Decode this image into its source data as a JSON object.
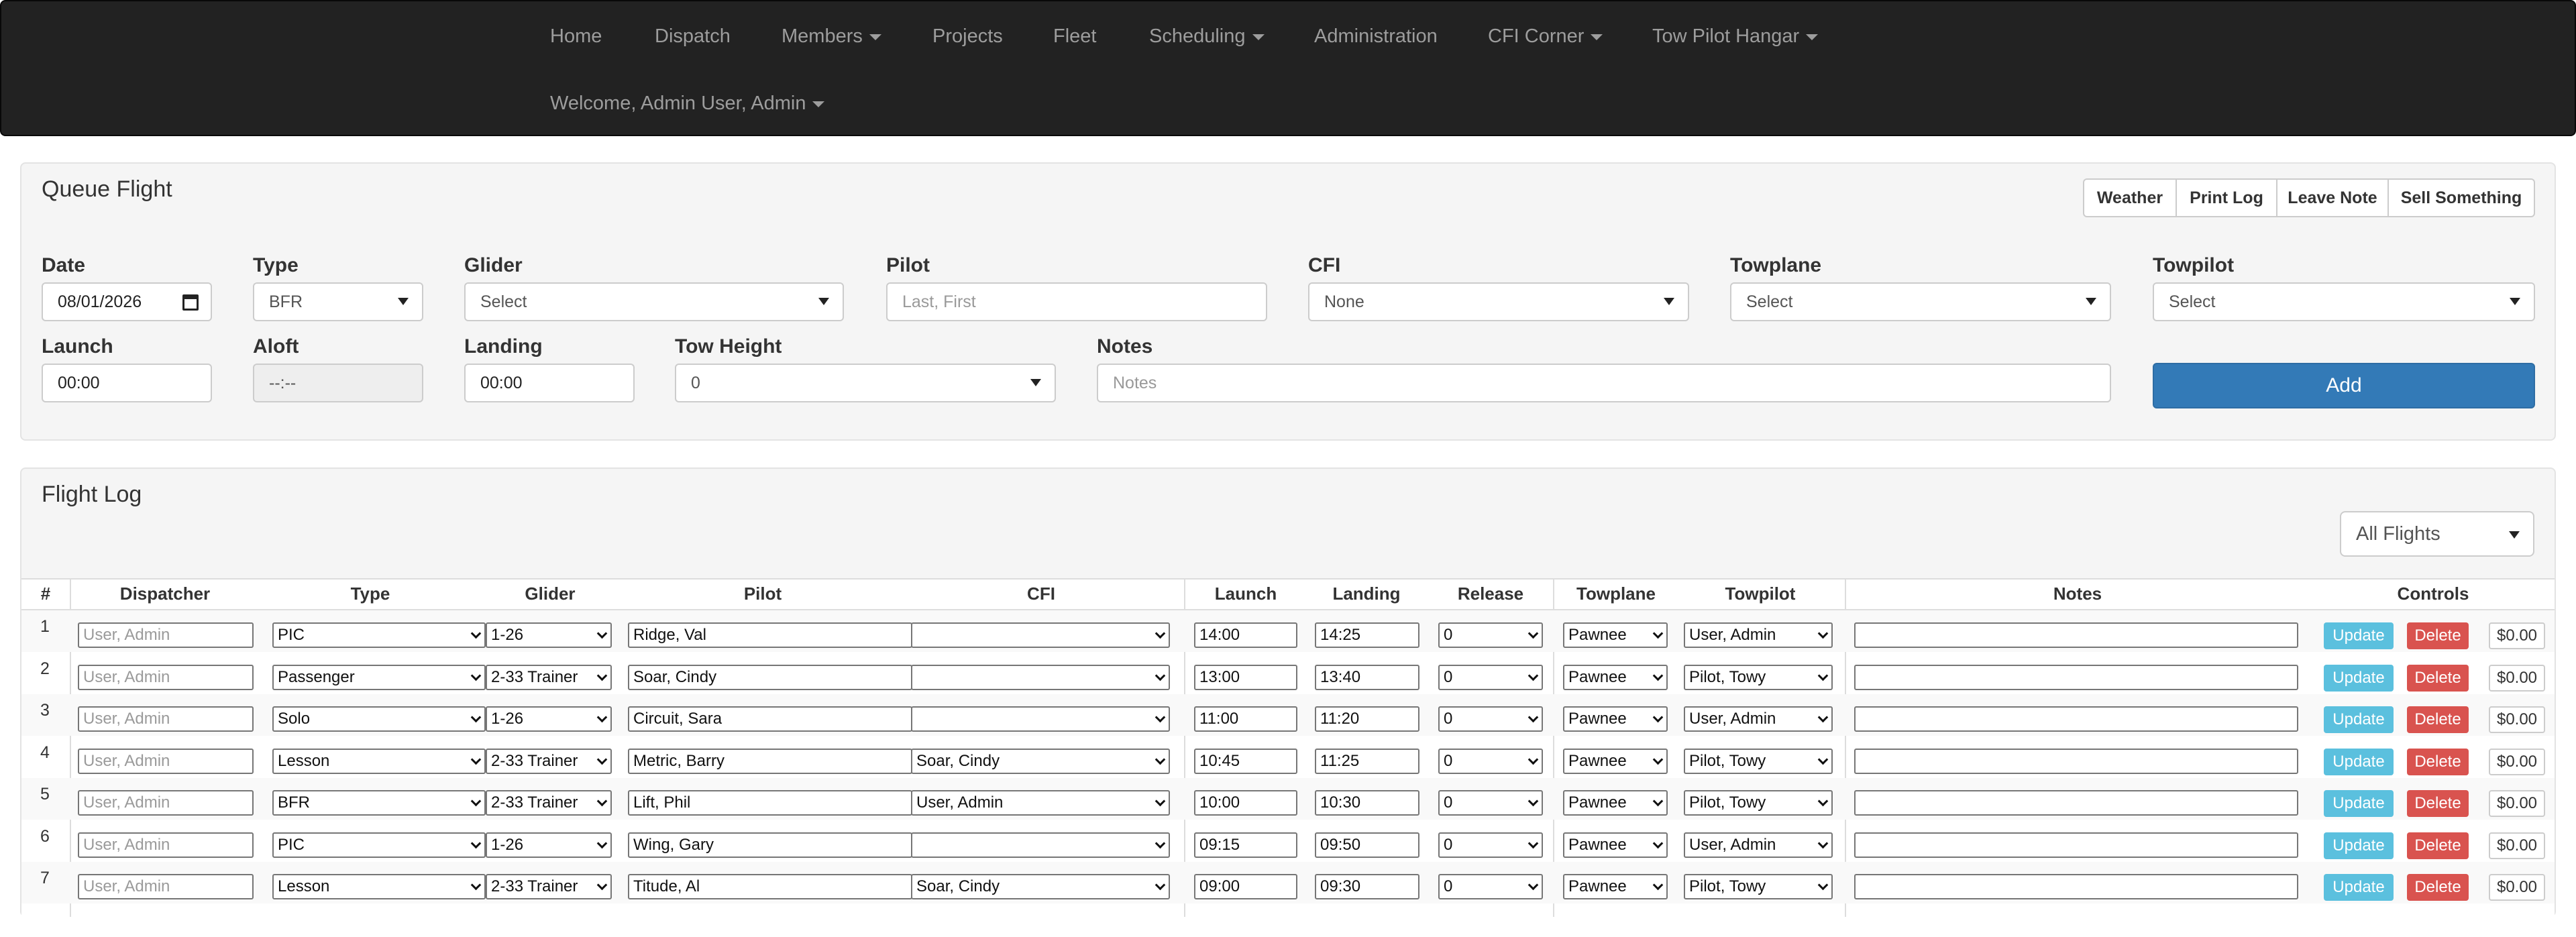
{
  "nav": {
    "row1": [
      {
        "label": "Home",
        "dropdown": false
      },
      {
        "label": "Dispatch",
        "dropdown": false
      },
      {
        "label": "Members",
        "dropdown": true
      },
      {
        "label": "Projects",
        "dropdown": false
      },
      {
        "label": "Fleet",
        "dropdown": false
      },
      {
        "label": "Scheduling",
        "dropdown": true
      },
      {
        "label": "Administration",
        "dropdown": false
      },
      {
        "label": "CFI Corner",
        "dropdown": true
      },
      {
        "label": "Tow Pilot Hangar",
        "dropdown": true
      }
    ],
    "welcome": "Welcome, Admin User, Admin"
  },
  "queue": {
    "title": "Queue Flight",
    "actions": [
      "Weather",
      "Print Log",
      "Leave Note",
      "Sell Something"
    ],
    "fields": {
      "date": {
        "label": "Date",
        "value": "08/01/2026"
      },
      "type": {
        "label": "Type",
        "value": "BFR"
      },
      "glider": {
        "label": "Glider",
        "value": "Select"
      },
      "pilot": {
        "label": "Pilot",
        "placeholder": "Last, First"
      },
      "cfi": {
        "label": "CFI",
        "value": "None"
      },
      "towplane": {
        "label": "Towplane",
        "value": "Select"
      },
      "towpilot": {
        "label": "Towpilot",
        "value": "Select"
      },
      "launch": {
        "label": "Launch",
        "value": "00:00"
      },
      "aloft": {
        "label": "Aloft",
        "value": "--:--"
      },
      "landing": {
        "label": "Landing",
        "value": "00:00"
      },
      "tow_height": {
        "label": "Tow Height",
        "value": "0"
      },
      "notes": {
        "label": "Notes",
        "placeholder": "Notes"
      }
    },
    "add_label": "Add"
  },
  "log": {
    "title": "Flight Log",
    "filter": "All Flights",
    "columns": [
      "#",
      "Dispatcher",
      "Type",
      "Glider",
      "Pilot",
      "CFI",
      "Launch",
      "Landing",
      "Release",
      "Towplane",
      "Towpilot",
      "Notes",
      "Controls"
    ],
    "dispatcher_placeholder": "User, Admin",
    "update_label": "Update",
    "delete_label": "Delete",
    "rows": [
      {
        "num": "1",
        "type": "PIC",
        "glider": "1-26",
        "pilot": "Ridge, Val",
        "cfi": "",
        "launch": "14:00",
        "landing": "14:25",
        "release": "0",
        "towplane": "Pawnee",
        "towpilot": "User, Admin",
        "notes": "",
        "price": "$0.00"
      },
      {
        "num": "2",
        "type": "Passenger",
        "glider": "2-33 Trainer",
        "pilot": "Soar, Cindy",
        "cfi": "",
        "launch": "13:00",
        "landing": "13:40",
        "release": "0",
        "towplane": "Pawnee",
        "towpilot": "Pilot, Towy",
        "notes": "",
        "price": "$0.00"
      },
      {
        "num": "3",
        "type": "Solo",
        "glider": "1-26",
        "pilot": "Circuit, Sara",
        "cfi": "",
        "launch": "11:00",
        "landing": "11:20",
        "release": "0",
        "towplane": "Pawnee",
        "towpilot": "User, Admin",
        "notes": "",
        "price": "$0.00"
      },
      {
        "num": "4",
        "type": "Lesson",
        "glider": "2-33 Trainer",
        "pilot": "Metric, Barry",
        "cfi": "Soar, Cindy",
        "launch": "10:45",
        "landing": "11:25",
        "release": "0",
        "towplane": "Pawnee",
        "towpilot": "Pilot, Towy",
        "notes": "",
        "price": "$0.00"
      },
      {
        "num": "5",
        "type": "BFR",
        "glider": "2-33 Trainer",
        "pilot": "Lift, Phil",
        "cfi": "User, Admin",
        "launch": "10:00",
        "landing": "10:30",
        "release": "0",
        "towplane": "Pawnee",
        "towpilot": "Pilot, Towy",
        "notes": "",
        "price": "$0.00"
      },
      {
        "num": "6",
        "type": "PIC",
        "glider": "1-26",
        "pilot": "Wing, Gary",
        "cfi": "",
        "launch": "09:15",
        "landing": "09:50",
        "release": "0",
        "towplane": "Pawnee",
        "towpilot": "User, Admin",
        "notes": "",
        "price": "$0.00"
      },
      {
        "num": "7",
        "type": "Lesson",
        "glider": "2-33 Trainer",
        "pilot": "Titude, Al",
        "cfi": "Soar, Cindy",
        "launch": "09:00",
        "landing": "09:30",
        "release": "0",
        "towplane": "Pawnee",
        "towpilot": "Pilot, Towy",
        "notes": "",
        "price": "$0.00"
      }
    ]
  }
}
